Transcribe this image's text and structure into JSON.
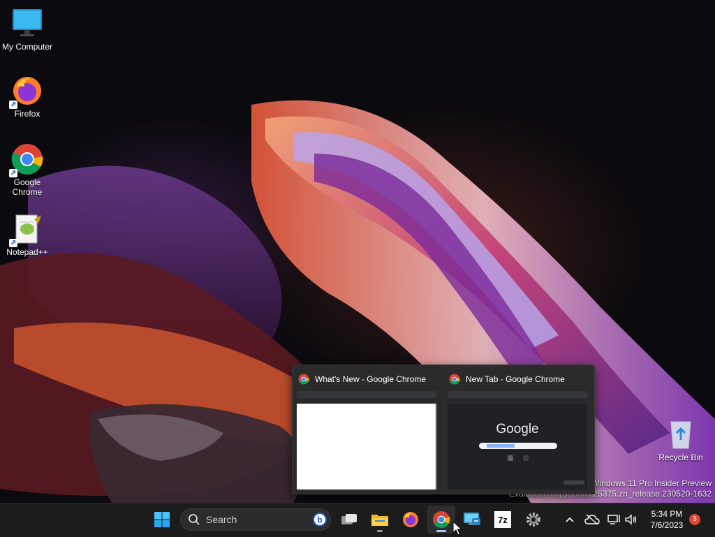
{
  "desktop": {
    "icons": [
      {
        "label": "My Computer"
      },
      {
        "label": "Firefox"
      },
      {
        "label": "Google Chrome"
      },
      {
        "label": "Notepad++"
      },
      {
        "label": "Recycle Bin"
      }
    ],
    "watermark": {
      "line1": "Windows 11 Pro Insider Preview",
      "line2": "Evaluation copy. Build 25375.zn_release.230520-1632"
    }
  },
  "thumbnails": [
    {
      "title": "What's New - Google Chrome"
    },
    {
      "title": "New Tab - Google Chrome",
      "preview_text": "Google"
    }
  ],
  "taskbar": {
    "search_label": "Search",
    "apps": [
      {
        "icon": "start-icon"
      },
      {
        "icon": "task-view-icon"
      },
      {
        "icon": "file-explorer-icon"
      },
      {
        "icon": "firefox-icon"
      },
      {
        "icon": "chrome-icon",
        "active": true
      },
      {
        "icon": "remote-desktop-icon"
      },
      {
        "icon": "7zip-icon",
        "label": "7z"
      },
      {
        "icon": "settings-icon"
      }
    ],
    "clock": {
      "time": "5:34 PM",
      "date": "7/6/2023"
    },
    "notification_count": "3"
  }
}
